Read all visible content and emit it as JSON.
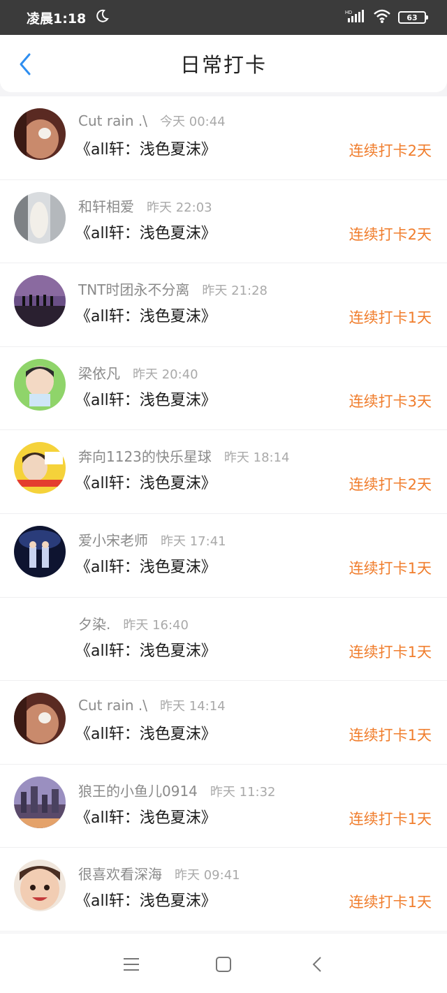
{
  "status_bar": {
    "time": "凌晨1:18",
    "battery": "63",
    "icons": [
      "moon-icon",
      "signal-hd-icon",
      "wifi-icon",
      "battery-icon"
    ]
  },
  "header": {
    "title": "日常打卡",
    "back_icon": "chevron-left-icon",
    "accent": "#2e8ef0"
  },
  "colors": {
    "streak": "#f07d2c",
    "name": "#8a8a8a",
    "time": "#a9a9a9"
  },
  "checkins": [
    {
      "name": "Cut rain .\\",
      "time": "今天 00:44",
      "book": "《all轩：浅色夏沫》",
      "streak": "连续打卡2天",
      "avatar": "photo-warm"
    },
    {
      "name": "和轩相爱",
      "time": "昨天 22:03",
      "book": "《all轩：浅色夏沫》",
      "streak": "连续打卡2天",
      "avatar": "photo-grey"
    },
    {
      "name": "TNT时团永不分离",
      "time": "昨天 21:28",
      "book": "《all轩：浅色夏沫》",
      "streak": "连续打卡1天",
      "avatar": "photo-sunset"
    },
    {
      "name": "梁依凡",
      "time": "昨天 20:40",
      "book": "《all轩：浅色夏沫》",
      "streak": "连续打卡3天",
      "avatar": "photo-green"
    },
    {
      "name": "奔向1123的快乐星球",
      "time": "昨天 18:14",
      "book": "《all轩：浅色夏沫》",
      "streak": "连续打卡2天",
      "avatar": "photo-yellow"
    },
    {
      "name": "爱小宋老师",
      "time": "昨天 17:41",
      "book": "《all轩：浅色夏沫》",
      "streak": "连续打卡1天",
      "avatar": "photo-stage"
    },
    {
      "name": "夕染.",
      "time": "昨天 16:40",
      "book": "《all轩：浅色夏沫》",
      "streak": "连续打卡1天",
      "avatar": "none"
    },
    {
      "name": "Cut rain .\\",
      "time": "昨天 14:14",
      "book": "《all轩：浅色夏沫》",
      "streak": "连续打卡1天",
      "avatar": "photo-warm"
    },
    {
      "name": "狼王的小鱼儿0914",
      "time": "昨天 11:32",
      "book": "《all轩：浅色夏沫》",
      "streak": "连续打卡1天",
      "avatar": "photo-city"
    },
    {
      "name": "很喜欢看深海",
      "time": "昨天 09:41",
      "book": "《all轩：浅色夏沫》",
      "streak": "连续打卡1天",
      "avatar": "photo-child"
    }
  ],
  "nav_bar": {
    "icons": [
      "menu-icon",
      "home-square-icon",
      "back-triangle-icon"
    ]
  }
}
